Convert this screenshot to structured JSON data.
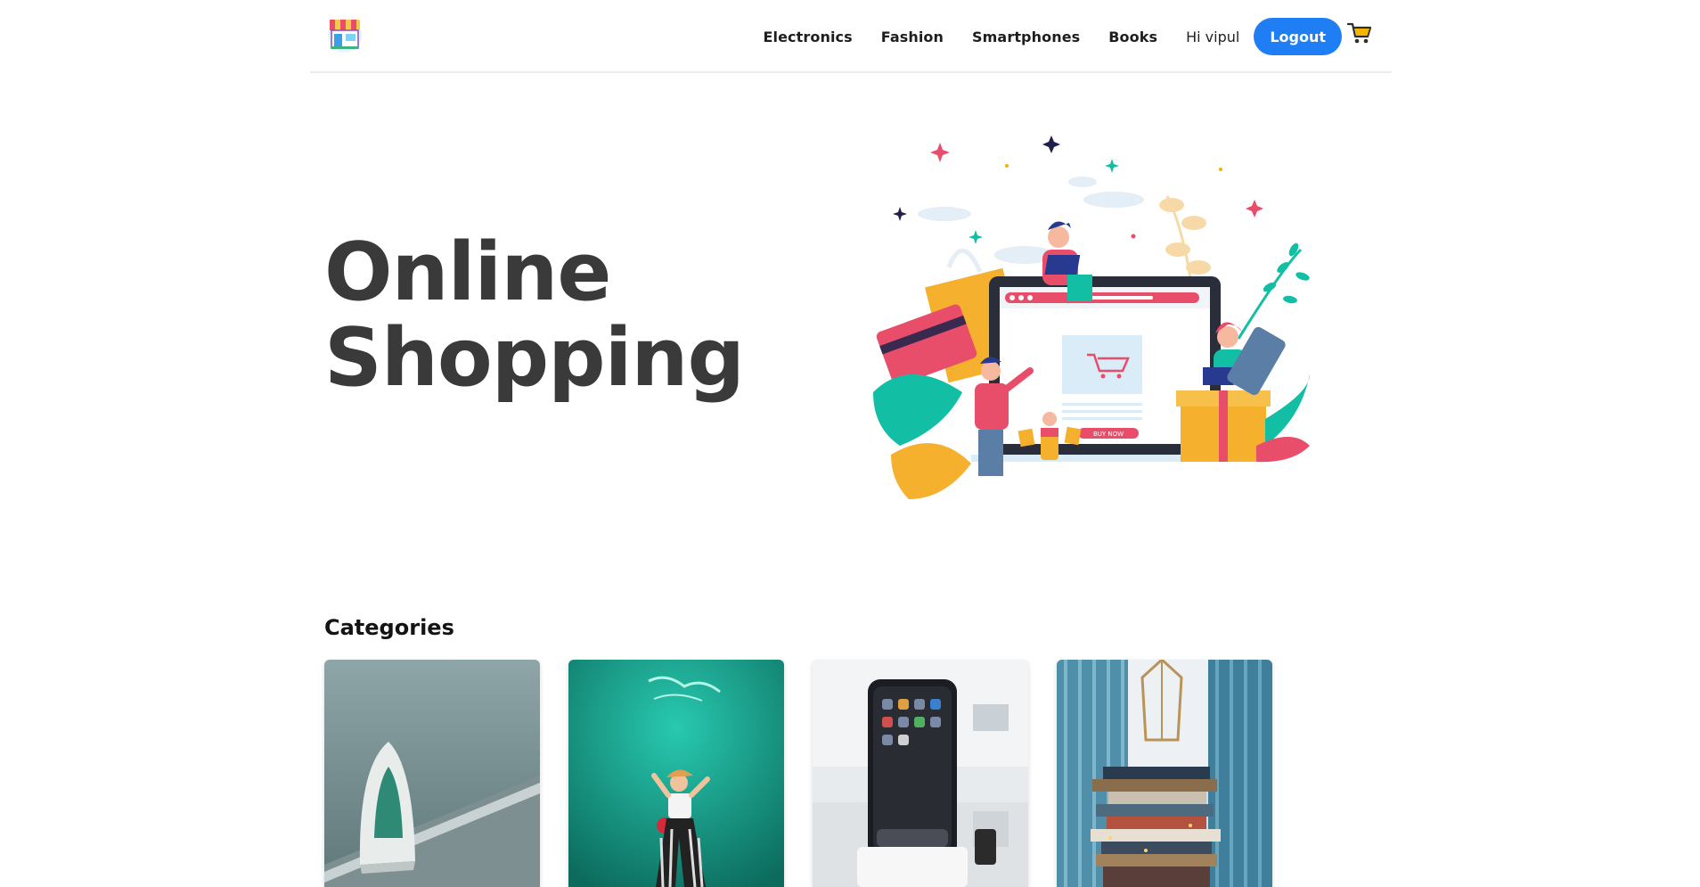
{
  "navbar": {
    "logo": "store-logo-icon",
    "links": [
      {
        "label": "Electronics"
      },
      {
        "label": "Fashion"
      },
      {
        "label": "Smartphones"
      },
      {
        "label": "Books"
      }
    ],
    "greeting": "Hi vipul",
    "logout_label": "Logout",
    "cart_icon": "shopping-cart-icon",
    "accent_color": "#1f7ef3"
  },
  "hero": {
    "title_line1": "Online",
    "title_line2": "Shopping",
    "illustration": "online-shopping-illustration",
    "illustration_button_label": "BUY NOW"
  },
  "categories": {
    "title": "Categories",
    "items": [
      {
        "image": "clothes-iron-photo"
      },
      {
        "image": "fashion-model-photo"
      },
      {
        "image": "smartphone-photo"
      },
      {
        "image": "book-stack-photo"
      }
    ]
  }
}
